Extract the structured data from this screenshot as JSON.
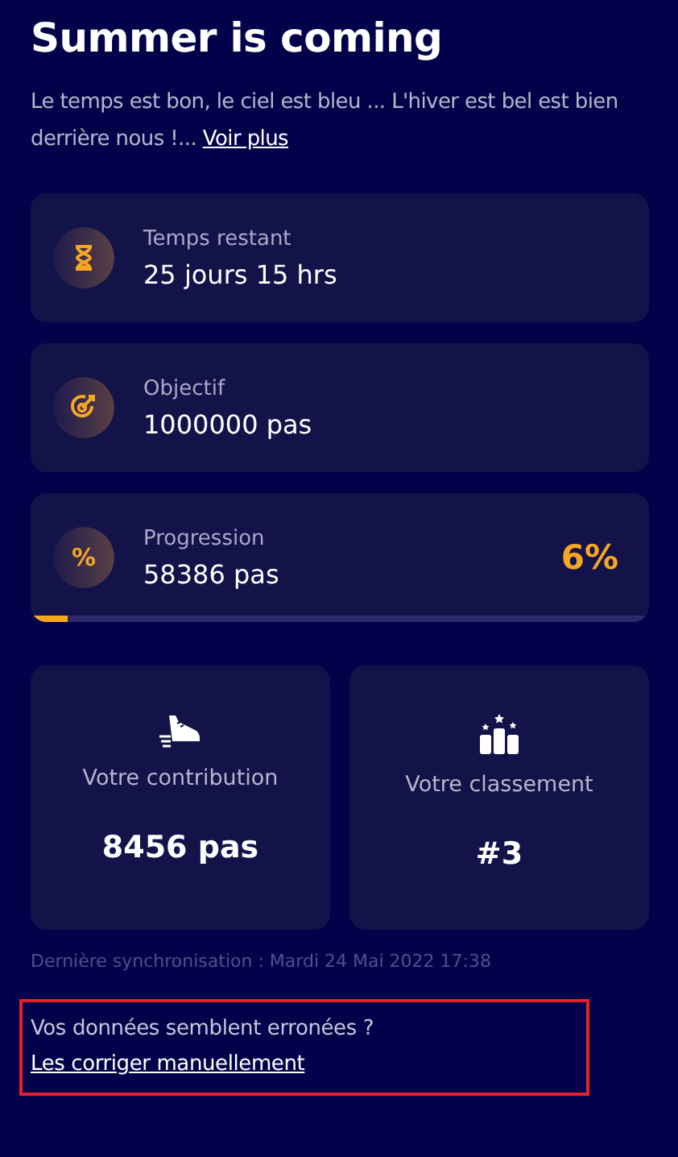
{
  "title": "Summer is coming",
  "description": "Le temps est bon, le ciel est bleu ... L'hiver est bel est bien derrière nous !...",
  "description_link": "Voir plus",
  "stats": [
    {
      "kind": "time",
      "label": "Temps restant",
      "value": "25 jours 15 hrs"
    },
    {
      "kind": "goal",
      "label": "Objectif",
      "value": "1000000 pas"
    },
    {
      "kind": "progress",
      "icon_text": "%",
      "label": "Progression",
      "value": "58386 pas",
      "percent": "6%",
      "level": 0.06
    }
  ],
  "tiles": [
    {
      "kind": "shoe",
      "label": "Votre contribution",
      "value": "8456 pas"
    },
    {
      "kind": "podium",
      "label": "Votre classement",
      "value": "#3"
    }
  ],
  "sync": "Dernière synchronisation : Mardi 24 Mai 2022 17:38",
  "correction": {
    "text": "Vos données semblent erronées ?",
    "link": "Les corriger manuellement"
  }
}
